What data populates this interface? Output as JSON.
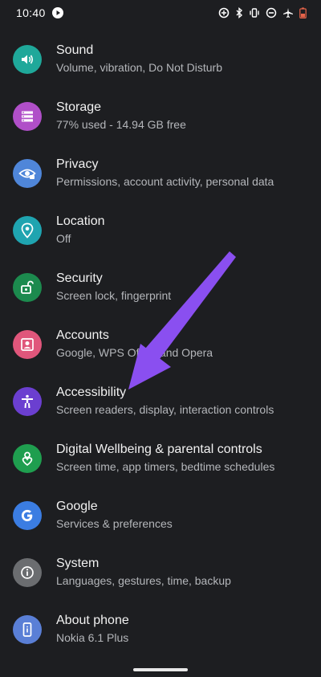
{
  "status_bar": {
    "time": "10:40"
  },
  "settings": [
    {
      "title": "Sound",
      "subtitle": "Volume, vibration, Do Not Disturb",
      "icon": "sound-icon",
      "color": "#1fa89a"
    },
    {
      "title": "Storage",
      "subtitle": "77% used - 14.94 GB free",
      "icon": "storage-icon",
      "color": "#b04fc8"
    },
    {
      "title": "Privacy",
      "subtitle": "Permissions, account activity, personal data",
      "icon": "privacy-icon",
      "color": "#4f86d9"
    },
    {
      "title": "Location",
      "subtitle": "Off",
      "icon": "location-icon",
      "color": "#1fa4b0"
    },
    {
      "title": "Security",
      "subtitle": "Screen lock, fingerprint",
      "icon": "lock-icon",
      "color": "#1c8a4e"
    },
    {
      "title": "Accounts",
      "subtitle": "Google, WPS Office and Opera",
      "icon": "accounts-icon",
      "color": "#e0567b"
    },
    {
      "title": "Accessibility",
      "subtitle": "Screen readers, display, interaction controls",
      "icon": "accessibility-icon",
      "color": "#6b3fd0"
    },
    {
      "title": "Digital Wellbeing & parental controls",
      "subtitle": "Screen time, app timers, bedtime schedules",
      "icon": "wellbeing-icon",
      "color": "#1f9e4f"
    },
    {
      "title": "Google",
      "subtitle": "Services & preferences",
      "icon": "google-icon",
      "color": "#3b7de2"
    },
    {
      "title": "System",
      "subtitle": "Languages, gestures, time, backup",
      "icon": "info-icon",
      "color": "#6b6d70"
    },
    {
      "title": "About phone",
      "subtitle": "Nokia 6.1 Plus",
      "icon": "phone-icon",
      "color": "#5a7fd6"
    }
  ],
  "colors": {
    "background": "#1d1e21",
    "arrow": "#8a4ff0"
  }
}
